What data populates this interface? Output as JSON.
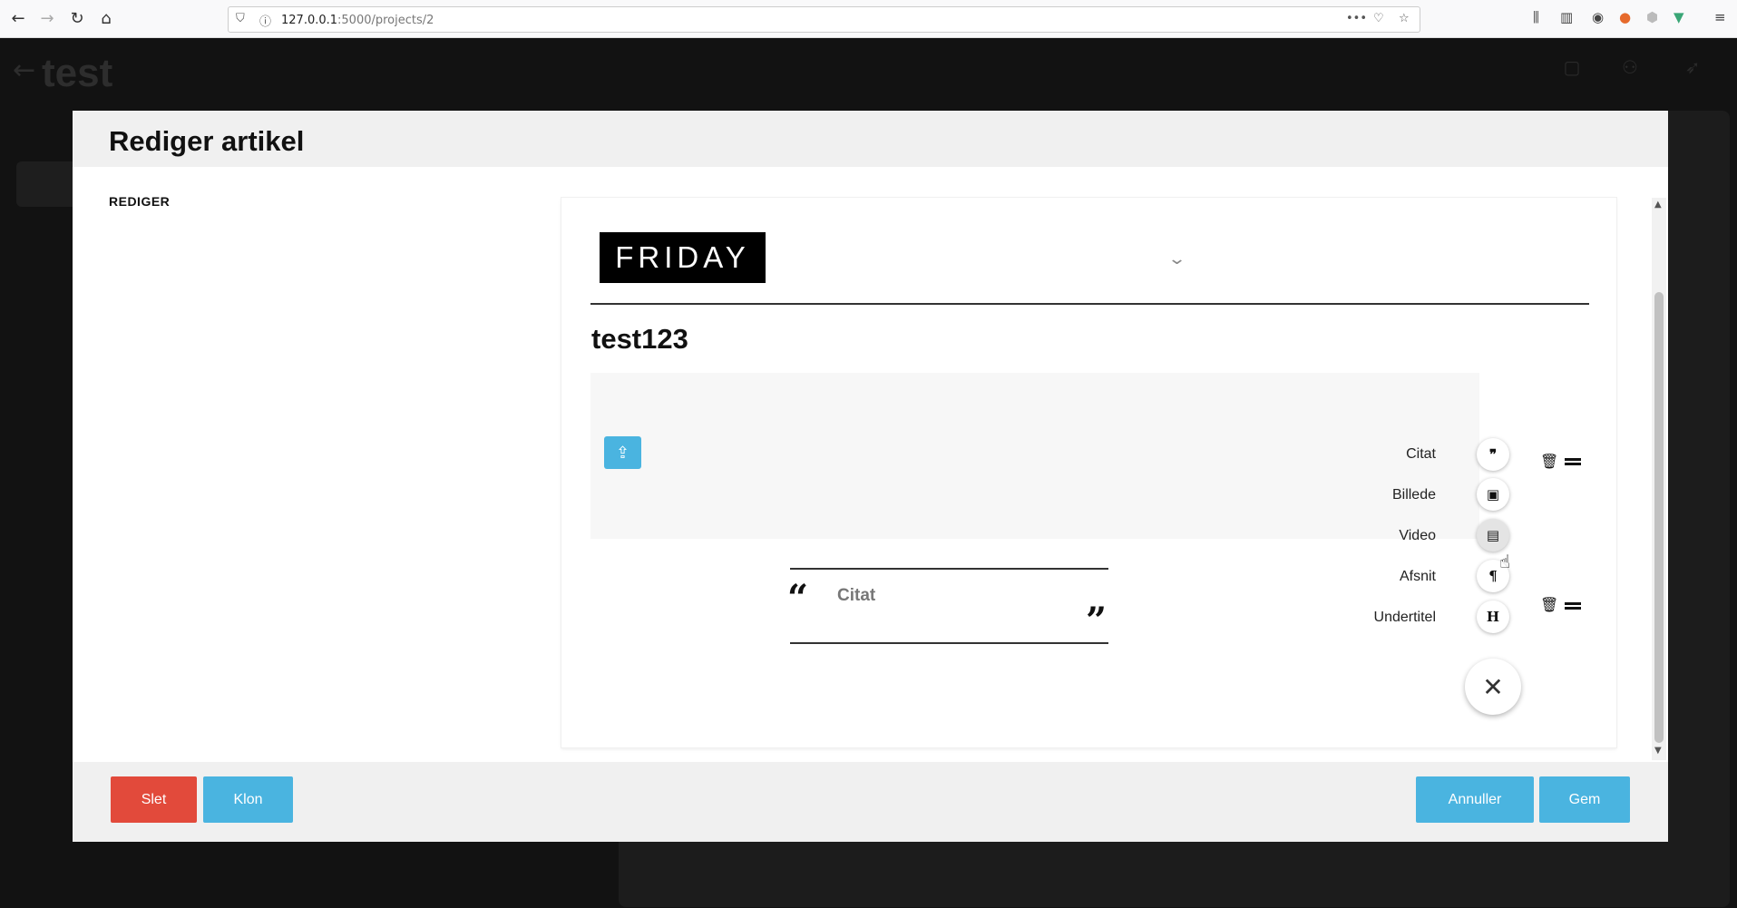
{
  "browser": {
    "url_host": "127.0.0.1",
    "url_path": ":5000/projects/2",
    "more_icon": "•••"
  },
  "app": {
    "title": "test"
  },
  "modal": {
    "title": "Rediger artikel",
    "section_label": "REDIGER",
    "logo_text": "FRIDAY",
    "article_title": "test123",
    "quote_placeholder": "Citat",
    "add_menu": [
      {
        "label": "Citat",
        "icon": "quote-icon",
        "glyph": "❞"
      },
      {
        "label": "Billede",
        "icon": "image-icon",
        "glyph": "▣"
      },
      {
        "label": "Video",
        "icon": "film-icon",
        "glyph": "▤"
      },
      {
        "label": "Afsnit",
        "icon": "paragraph-icon",
        "glyph": "¶"
      },
      {
        "label": "Undertitel",
        "icon": "heading-icon",
        "glyph": "H"
      }
    ],
    "buttons": {
      "delete": "Slet",
      "clone": "Klon",
      "cancel": "Annuller",
      "save": "Gem"
    }
  },
  "colors": {
    "accent_blue": "#4ab4e0",
    "danger_red": "#e24a3b"
  }
}
